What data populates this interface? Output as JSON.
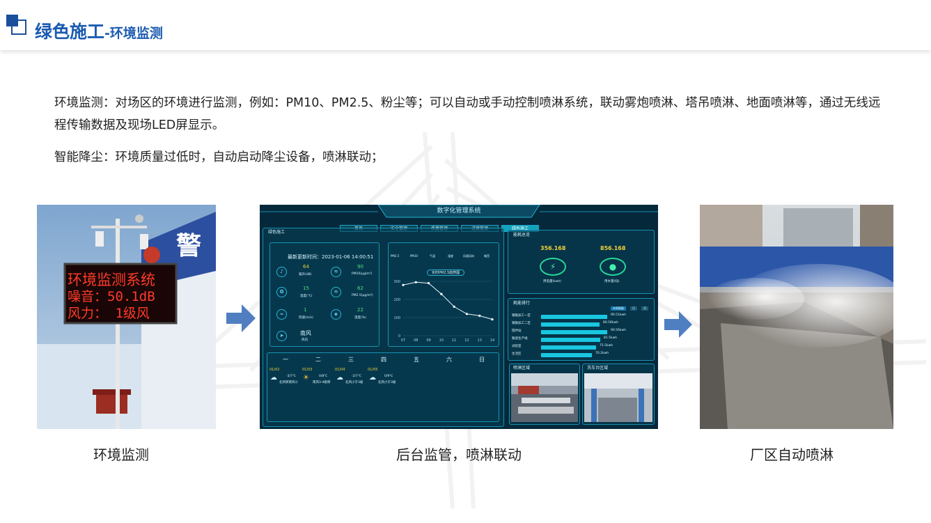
{
  "header": {
    "title_main": "绿色施工",
    "title_sub": "-环境监测"
  },
  "paragraphs": {
    "p1": "环境监测：对场区的环境进行监测，例如：PM10、PM2.5、粉尘等；可以自动或手动控制喷淋系统，联动雾炮喷淋、塔吊喷淋、地面喷淋等，通过无线远程传输数据及现场LED屏显示。",
    "p2": "智能降尘：环境质量过低时，自动启动降尘设备，喷淋联动；"
  },
  "captions": {
    "left": "环境监测",
    "middle": "后台监管，喷淋联动",
    "right": "厂区自动喷淋"
  },
  "led_sign": {
    "line1": "环境监测系统",
    "line2": "噪音：50.1dB",
    "line3": "风力： 1级风",
    "police_char": "警"
  },
  "dashboard": {
    "title": "数字化管理系统",
    "tabs": [
      "首页",
      "安全管理",
      "质量管理",
      "进度管理",
      "绿色施工"
    ],
    "left_panel_title": "绿色施工",
    "update_time": "最新更新时间：2023-01-06 14:00:51",
    "metrics": [
      {
        "value": "64",
        "label": "噪声(dB)"
      },
      {
        "value": "90",
        "label": "PM10(μg/m³)"
      },
      {
        "value": "15",
        "label": "温度(℃)"
      },
      {
        "value": "62",
        "label": "PM2.5(μg/m³)"
      },
      {
        "value": "1",
        "label": "风速(m/s)"
      },
      {
        "value": "22",
        "label": "湿度(%)"
      }
    ],
    "wind_dir": "南风",
    "wind_label": "风向",
    "chart_tabs": [
      "PM2.5",
      "PM10",
      "气温",
      "湿度",
      "风速风向",
      "噪音"
    ],
    "chart_caption": "实时PM2.5趋势图",
    "week_days": [
      "一",
      "二",
      "三",
      "四",
      "五",
      "六",
      "日"
    ],
    "forecast": [
      {
        "date": "01/02",
        "temp": "-3/7℃",
        "desc": "北风转南风小"
      },
      {
        "date": "01/03",
        "temp": "0/8℃",
        "desc": "南风3-4级转"
      },
      {
        "date": "01/04",
        "temp": "-2/7℃",
        "desc": "北风小于3级"
      },
      {
        "date": "01/05",
        "temp": "0/9℃",
        "desc": "北风小于3级"
      }
    ],
    "energy_title": "能耗总览",
    "energy": [
      {
        "value": "356.168",
        "label": "用电量(kwh)"
      },
      {
        "value": "856.168",
        "label": "用水量(吨)"
      }
    ],
    "rank_title": "耗能排行",
    "rank_buttons": [
      "本周耗能",
      "日",
      "月"
    ],
    "rank": [
      {
        "name": "钢筋加工一区",
        "value": "90.51kwh",
        "pct": 0.95
      },
      {
        "name": "钢筋加工二区",
        "value": "80.56kwh",
        "pct": 0.84
      },
      {
        "name": "搅拌站",
        "value": "90.56kwh",
        "pct": 0.95
      },
      {
        "name": "隧道生产线",
        "value": "81.5kwh",
        "pct": 0.85
      },
      {
        "name": "试验室",
        "value": "75.5kwh",
        "pct": 0.79
      },
      {
        "name": "生活区",
        "value": "70.2kwh",
        "pct": 0.73
      }
    ],
    "cam_titles": [
      "喷淋区域",
      "洗车台区域"
    ]
  },
  "chart_data": {
    "type": "line",
    "title": "实时PM2.5趋势图",
    "x": [
      7,
      8,
      9,
      10,
      11,
      12,
      13,
      14
    ],
    "x_ticks": [
      "07",
      "08",
      "09",
      "10",
      "11",
      "12",
      "13",
      "14"
    ],
    "values": [
      280,
      295,
      290,
      230,
      160,
      120,
      110,
      90
    ],
    "ylim": [
      0,
      300
    ],
    "y_ticks": [
      "0",
      "100",
      "200",
      "300"
    ]
  },
  "colors": {
    "brand": "#1b5bb0",
    "arrow": "#4f7fc1",
    "dash_bg": "#062a3c",
    "dash_border": "#1792b3"
  }
}
